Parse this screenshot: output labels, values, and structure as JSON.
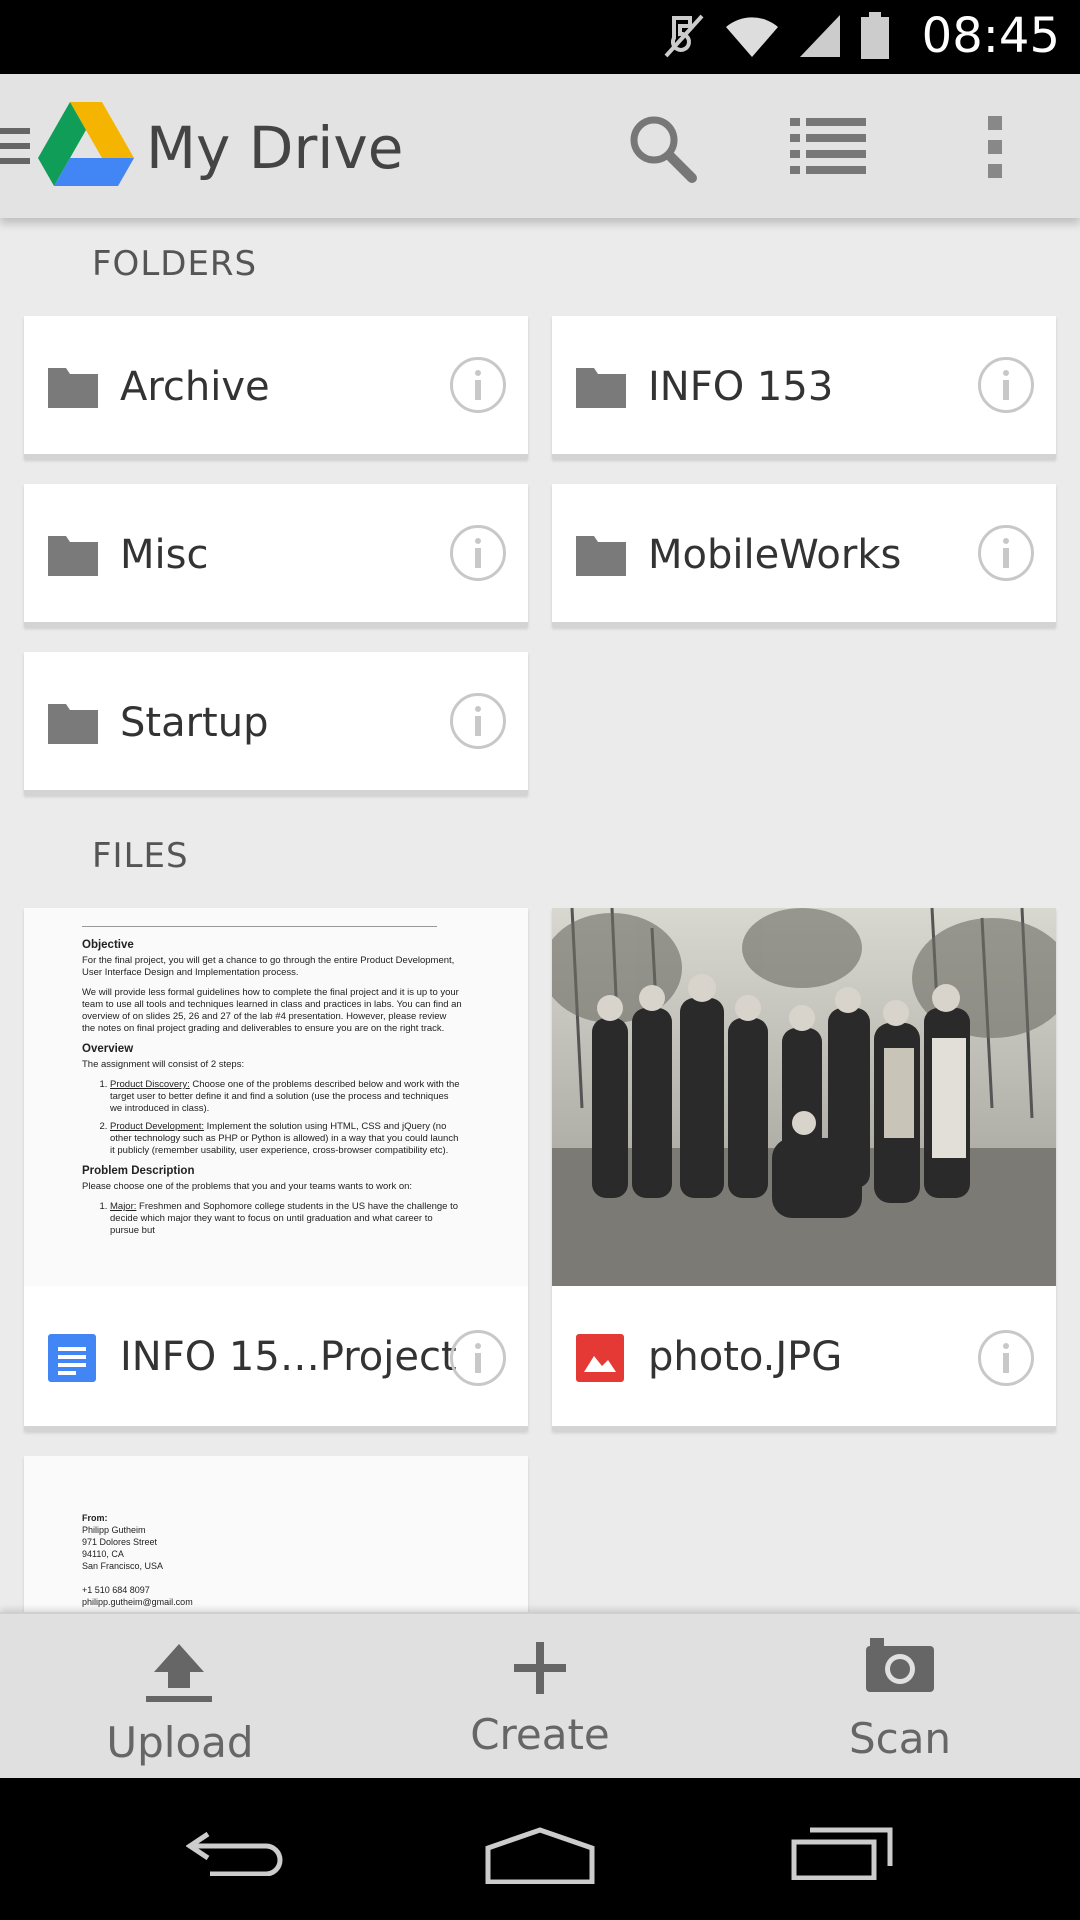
{
  "status_bar": {
    "time": "08:45"
  },
  "app_bar": {
    "title": "My Drive"
  },
  "folders_section": {
    "label": "FOLDERS",
    "folders": [
      {
        "name": "Archive"
      },
      {
        "name": "INFO 153"
      },
      {
        "name": "Misc"
      },
      {
        "name": "MobileWorks"
      },
      {
        "name": "Startup"
      }
    ]
  },
  "files_section": {
    "label": "FILES",
    "files": [
      {
        "name": "INFO 15…Project",
        "type": "document",
        "icon_color": "#4285f4"
      },
      {
        "name": "photo.JPG",
        "type": "image",
        "icon_color": "#e53935"
      }
    ],
    "doc_preview": {
      "objective_heading": "Objective",
      "objective_p1": "For the final project, you will get a chance to go through the entire Product Development, User Interface Design and Implementation process.",
      "objective_p2": "We will provide less formal guidelines how to complete the final project and it is up to your team to use all tools and techniques learned in class and practices in labs. You can find an overview of on slides 25, 26 and 27 of the lab #4 presentation. However, please review the notes on final project grading and deliverables to ensure you are on the right track.",
      "overview_heading": "Overview",
      "overview_p": "The assignment will consist of 2 steps:",
      "step1_label": "Product Discovery:",
      "step1_text": " Choose one of the problems described below and work with the target user to better define it and find a solution (use the process and techniques we introduced in class).",
      "step2_label": "Product Development:",
      "step2_text": " Implement the solution using HTML, CSS and jQuery (no other technology such as PHP or Python is allowed) in a way that you could launch it publicly (remember usability, user experience, cross-browser compatibility etc).",
      "problem_heading": "Problem Description",
      "problem_p": "Please choose one of the problems that you and your teams wants to work on:",
      "major_label": "Major:",
      "major_text": " Freshmen and Sophomore college students in the US have the challenge to decide which major they want to focus on until graduation and what career to pursue but"
    },
    "letter_preview": {
      "from": "From:",
      "line1": "Philipp Gutheim",
      "line2": "971 Dolores Street",
      "line3": "94110, CA",
      "line4": "San Francisco, USA",
      "phone": "+1 510 684 8097",
      "email": "philipp.gutheim@gmail.com"
    }
  },
  "bottom_actions": {
    "upload": "Upload",
    "create": "Create",
    "scan": "Scan"
  },
  "colors": {
    "drive_green": "#0f9d58",
    "drive_yellow": "#f4b400",
    "drive_blue": "#4285f4",
    "folder_gray": "#7a7a7a"
  }
}
